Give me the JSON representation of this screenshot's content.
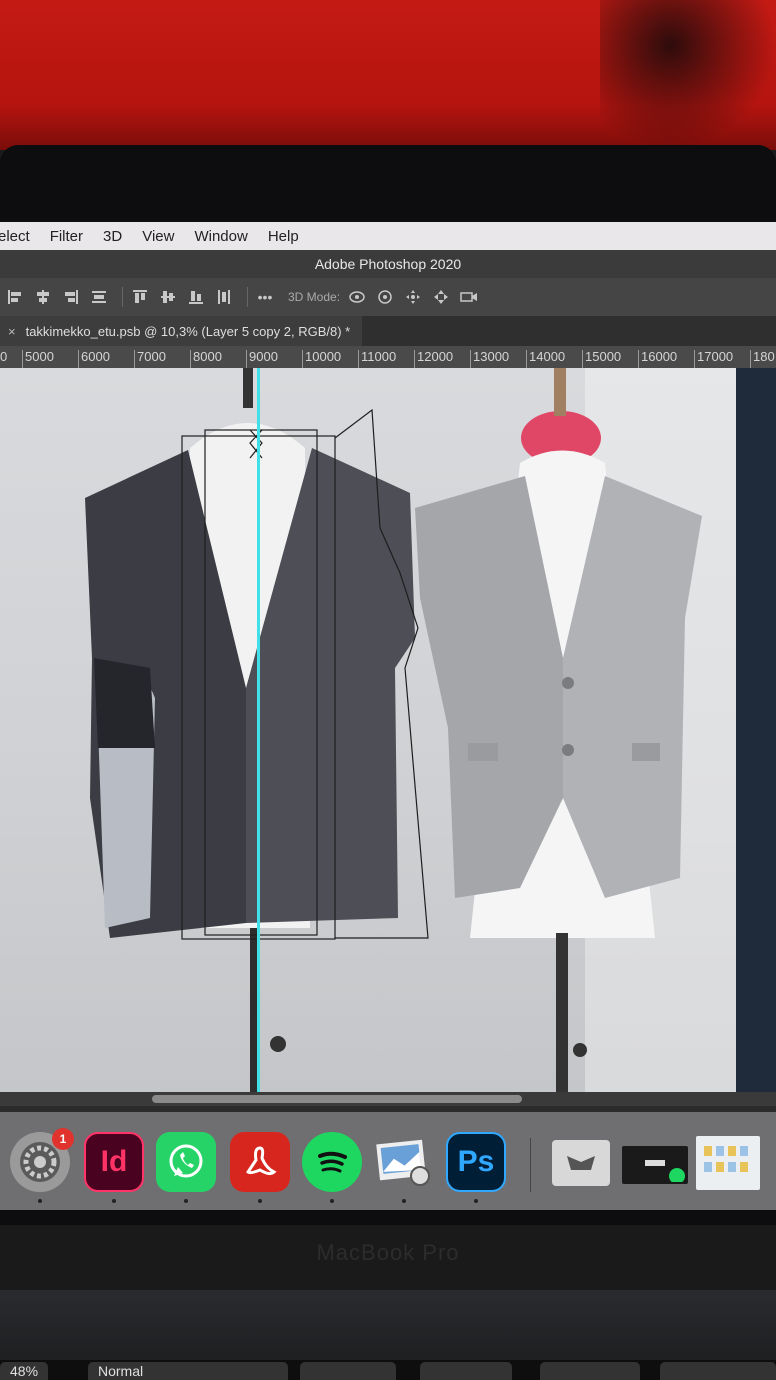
{
  "menu": {
    "items": [
      "elect",
      "Filter",
      "3D",
      "View",
      "Window",
      "Help"
    ]
  },
  "window": {
    "title": "Adobe Photoshop 2020"
  },
  "options": {
    "mode_label": "3D Mode:",
    "more": "•••"
  },
  "document_tab": {
    "close": "×",
    "label": "takkimekko_etu.psb @ 10,3% (Layer 5 copy 2, RGB/8) *"
  },
  "ruler": {
    "ticks": [
      "0",
      "5000",
      "6000",
      "7000",
      "8000",
      "9000",
      "10000",
      "11000",
      "12000",
      "13000",
      "14000",
      "15000",
      "16000",
      "17000",
      "180"
    ]
  },
  "dock": {
    "badge": "1",
    "apps": [
      {
        "name": "System Preferences",
        "icon": "gear-icon"
      },
      {
        "name": "InDesign",
        "label": "Id"
      },
      {
        "name": "WhatsApp",
        "icon": "whatsapp-icon"
      },
      {
        "name": "Acrobat",
        "icon": "acrobat-icon"
      },
      {
        "name": "Spotify",
        "icon": "spotify-icon"
      },
      {
        "name": "Preview",
        "icon": "preview-icon"
      },
      {
        "name": "Photoshop",
        "label": "Ps"
      }
    ]
  },
  "laptop": {
    "brand": "MacBook Pro"
  },
  "touchbar": {
    "zoom": "48%",
    "blend": "Normal"
  },
  "colors": {
    "wall": "#c41a14",
    "guide": "#3fe0e8",
    "ps_blue": "#31a8ff",
    "id_pink": "#ff3366"
  }
}
